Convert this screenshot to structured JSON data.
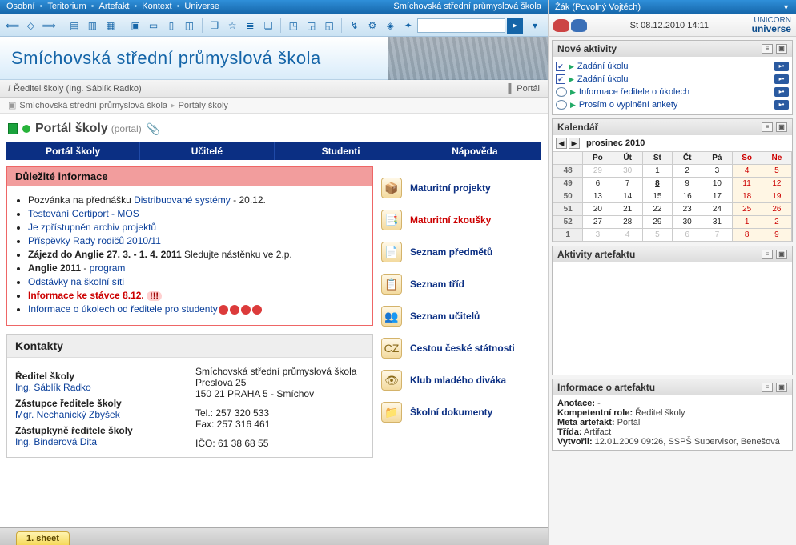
{
  "topnav": {
    "items": [
      "Osobní",
      "Teritorium",
      "Artefakt",
      "Kontext",
      "Universe"
    ],
    "right": "Smíchovská střední průmyslová škola"
  },
  "banner": {
    "title": "Smíchovská střední průmyslová škola"
  },
  "subbar": {
    "director_label": "Ředitel školy (Ing. Sáblík Radko)",
    "portal": "Portál"
  },
  "breadcrumb": {
    "root": "Smíchovská střední průmyslová škola",
    "leaf": "Portály školy"
  },
  "page_head": {
    "title": "Portál školy",
    "sub": "(portal)"
  },
  "tabs": [
    "Portál školy",
    "Učitelé",
    "Studenti",
    "Nápověda"
  ],
  "important": {
    "title": "Důležité informace",
    "items": [
      {
        "pre": "Pozvánka na přednášku ",
        "link": "Distribuované systémy",
        "post": " - 20.12."
      },
      {
        "link": "Testování Certiport - MOS"
      },
      {
        "link": "Je zpřístupněn archiv projektů"
      },
      {
        "link": " Příspěvky Rady rodičů 2010/11"
      },
      {
        "bold": "Zájezd do Anglie 27. 3. - 1. 4. 2011",
        "post": " Sledujte nástěnku ve 2.p."
      },
      {
        "bold": "Anglie 2011",
        "post_link": "program"
      },
      {
        "pink": "Odstávky na školní síti"
      },
      {
        "red": "Informace ke stávce 8.12.",
        "exca": true
      },
      {
        "link": "Informace o úkolech od ředitele pro studenty",
        "smileys": 4
      }
    ]
  },
  "rnav": [
    {
      "ico": "📦",
      "label": "Maturitní projekty",
      "red": false
    },
    {
      "ico": "📑",
      "label": "Maturitní zkoušky",
      "red": true
    },
    {
      "ico": "📄",
      "label": "Seznam předmětů",
      "red": false
    },
    {
      "ico": "📋",
      "label": "Seznam tříd",
      "red": false
    },
    {
      "ico": "👥",
      "label": "Seznam učitelů",
      "red": false
    },
    {
      "ico": "CZ",
      "label": "Cestou české státnosti",
      "red": false
    },
    {
      "ico": "👁",
      "label": "Klub mladého diváka",
      "red": false
    },
    {
      "ico": "📁",
      "label": "Školní dokumenty",
      "red": false
    }
  ],
  "kontakty": {
    "title": "Kontakty",
    "l": [
      {
        "label": "Ředitel školy",
        "link": "Ing. Sáblík Radko"
      },
      {
        "label": "Zástupce ředitele školy",
        "link": "Mgr. Nechanický Zbyšek"
      },
      {
        "label": "Zástupkyně ředitele školy",
        "link": "Ing. Binderová Dita"
      }
    ],
    "r": [
      "Smíchovská střední průmyslová škola",
      "Preslova 25",
      "150 21  PRAHA 5 - Smíchov",
      "",
      "Tel.: 257 320 533",
      "Fax: 257 316 461",
      "",
      "IČO: 61 38 68 55"
    ]
  },
  "footer": {
    "sheet": "1. sheet"
  },
  "side": {
    "user": "Žák (Povolný Vojtěch)",
    "datetime": "St 08.12.2010 14:11",
    "brand_top": "UNICORN",
    "brand_bot": "universe",
    "activities": {
      "title": "Nové aktivity",
      "items": [
        {
          "cb": true,
          "text": "Zadání úkolu"
        },
        {
          "cb": true,
          "text": "Zadání úkolu"
        },
        {
          "cb": false,
          "text": "Informace ředitele o úkolech"
        },
        {
          "cb": false,
          "text": "Prosím o vyplnění ankety"
        }
      ]
    },
    "calendar": {
      "title": "Kalendář",
      "month": "prosinec 2010",
      "dow": [
        "Po",
        "Út",
        "St",
        "Čt",
        "Pá",
        "So",
        "Ne"
      ],
      "weeks": [
        {
          "wk": "48",
          "d": [
            {
              "v": "29",
              "g": 1
            },
            {
              "v": "30",
              "g": 1
            },
            {
              "v": "1"
            },
            {
              "v": "2"
            },
            {
              "v": "3"
            },
            {
              "v": "4",
              "w": 1
            },
            {
              "v": "5",
              "w": 1
            }
          ]
        },
        {
          "wk": "49",
          "d": [
            {
              "v": "6"
            },
            {
              "v": "7"
            },
            {
              "v": "8",
              "t": 1
            },
            {
              "v": "9"
            },
            {
              "v": "10"
            },
            {
              "v": "11",
              "w": 1
            },
            {
              "v": "12",
              "w": 1
            }
          ]
        },
        {
          "wk": "50",
          "d": [
            {
              "v": "13"
            },
            {
              "v": "14"
            },
            {
              "v": "15"
            },
            {
              "v": "16"
            },
            {
              "v": "17"
            },
            {
              "v": "18",
              "w": 1
            },
            {
              "v": "19",
              "w": 1
            }
          ]
        },
        {
          "wk": "51",
          "d": [
            {
              "v": "20"
            },
            {
              "v": "21"
            },
            {
              "v": "22"
            },
            {
              "v": "23"
            },
            {
              "v": "24"
            },
            {
              "v": "25",
              "w": 1
            },
            {
              "v": "26",
              "w": 1
            }
          ]
        },
        {
          "wk": "52",
          "d": [
            {
              "v": "27"
            },
            {
              "v": "28"
            },
            {
              "v": "29"
            },
            {
              "v": "30"
            },
            {
              "v": "31"
            },
            {
              "v": "1",
              "g": 1,
              "w": 1
            },
            {
              "v": "2",
              "g": 1,
              "w": 1
            }
          ]
        },
        {
          "wk": "1",
          "d": [
            {
              "v": "3",
              "g": 1
            },
            {
              "v": "4",
              "g": 1
            },
            {
              "v": "5",
              "g": 1
            },
            {
              "v": "6",
              "g": 1
            },
            {
              "v": "7",
              "g": 1
            },
            {
              "v": "8",
              "g": 1,
              "w": 1
            },
            {
              "v": "9",
              "g": 1,
              "w": 1
            }
          ]
        }
      ]
    },
    "act_art": {
      "title": "Aktivity artefaktu"
    },
    "info": {
      "title": "Informace o artefaktu",
      "rows": [
        {
          "k": "Anotace:",
          "v": "-"
        },
        {
          "k": "Kompetentní role:",
          "v": "Ředitel školy"
        },
        {
          "k": "Meta artefakt:",
          "v": "Portál"
        },
        {
          "k": "Třída:",
          "v": "Artifact"
        },
        {
          "k": "Vytvořil:",
          "v": "12.01.2009 09:26, SSPŠ Supervisor, Benešová"
        }
      ]
    }
  }
}
